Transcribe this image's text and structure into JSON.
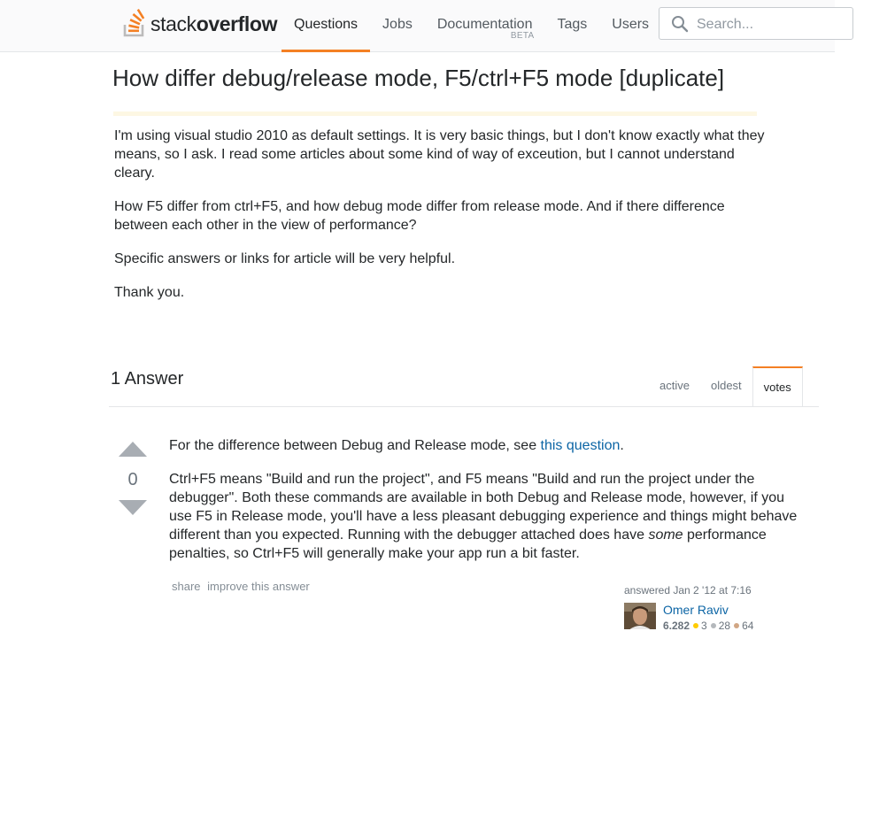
{
  "header": {
    "logo_word_1": "stack",
    "logo_word_2": "overflow",
    "nav": [
      {
        "label": "Questions"
      },
      {
        "label": "Jobs"
      },
      {
        "label": "Documentation",
        "badge": "BETA"
      },
      {
        "label": "Tags"
      },
      {
        "label": "Users"
      }
    ],
    "search_placeholder": "Search..."
  },
  "question": {
    "title": "How differ debug/release mode, F5/ctrl+F5 mode [duplicate]",
    "paragraphs": [
      "I'm using visual studio 2010 as default settings. It is very basic things, but I don't know exactly what they means, so I ask. I read some articles about some kind of way of exceution, but I cannot understand cleary.",
      "How F5 differ from ctrl+F5, and how debug mode differ from release mode. And if there difference between each other in the view of performance?",
      "Specific answers or links for article will be very helpful.",
      "Thank you."
    ]
  },
  "answers_header": {
    "count_label": "1 Answer",
    "tabs": [
      {
        "label": "active"
      },
      {
        "label": "oldest"
      },
      {
        "label": "votes"
      }
    ]
  },
  "answer": {
    "votes": "0",
    "p1_before": "For the difference between Debug and Release mode, see ",
    "p1_link": "this question",
    "p1_after": ".",
    "p2_before": "Ctrl+F5 means \"Build and run the project\", and F5 means \"Build and run the project under the debugger\". Both these commands are available in both Debug and Release mode, however, if you use F5 in Release mode, you'll have a less pleasant debugging experience and things might behave different than you expected. Running with the debugger attached does have ",
    "p2_em": "some",
    "p2_after": " performance penalties, so Ctrl+F5 will generally make your app run a bit faster.",
    "menu": {
      "share": "share",
      "improve": "improve this answer"
    },
    "user": {
      "action": "answered Jan 2 '12 at 7:16",
      "name": "Omer Raviv",
      "reputation": "6,282",
      "gold": "3",
      "silver": "28",
      "bronze": "64"
    }
  },
  "colors": {
    "accent": "#f48024",
    "link": "#0c65a5",
    "gold": "#ffcc01",
    "silver": "#b4b8bc",
    "bronze": "#d1a684"
  }
}
